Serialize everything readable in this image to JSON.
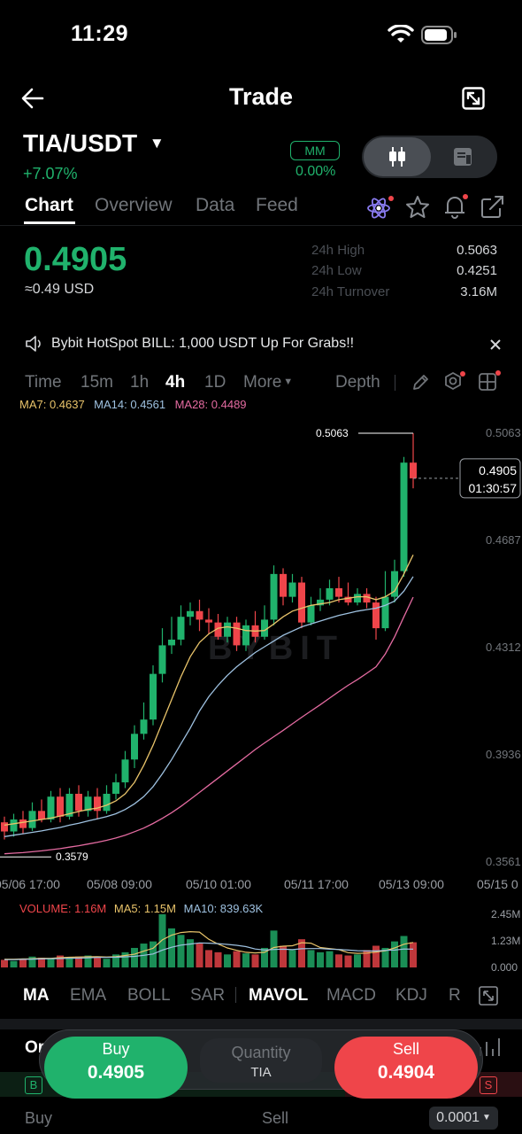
{
  "status": {
    "time": "11:29"
  },
  "header": {
    "title": "Trade"
  },
  "pair": {
    "symbol": "TIA/USDT",
    "change": "+7.07%",
    "mm_badge": "MM",
    "mm_value": "0.00%"
  },
  "tabs": [
    {
      "label": "Chart"
    },
    {
      "label": "Overview"
    },
    {
      "label": "Data"
    },
    {
      "label": "Feed"
    }
  ],
  "price": {
    "last": "0.4905",
    "usd": "≈0.49 USD"
  },
  "stats": [
    {
      "label": "24h High",
      "value": "0.5063"
    },
    {
      "label": "24h Low",
      "value": "0.4251"
    },
    {
      "label": "24h Turnover",
      "value": "3.16M"
    }
  ],
  "announcement": {
    "text": "Bybit HotSpot BILL: 1,000 USDT Up For Grabs!!"
  },
  "timeframes": [
    {
      "label": "Time"
    },
    {
      "label": "15m"
    },
    {
      "label": "1h"
    },
    {
      "label": "4h"
    },
    {
      "label": "1D"
    },
    {
      "label": "More"
    }
  ],
  "depth_label": "Depth",
  "ma_legend": {
    "ma7": "MA7: 0.4637",
    "ma14": "MA14: 0.4561",
    "ma28": "MA28: 0.4489"
  },
  "chart_data": {
    "type": "candlestick",
    "y_ticks": [
      "0.5063",
      "0.4687",
      "0.4312",
      "0.3936",
      "0.3561"
    ],
    "x_ticks": [
      "05/06 17:00",
      "05/08 09:00",
      "05/10 01:00",
      "05/11 17:00",
      "05/13 09:00",
      "05/15 0"
    ],
    "high_marker": "0.5063",
    "low_marker": "0.3579",
    "current_price": "0.4905",
    "countdown": "01:30:57",
    "watermark": "BYBIT",
    "ylim": [
      0.3561,
      0.5063
    ],
    "candles": [
      [
        0.37,
        0.3668,
        0.372,
        0.364
      ],
      [
        0.3668,
        0.371,
        0.373,
        0.365
      ],
      [
        0.371,
        0.368,
        0.374,
        0.366
      ],
      [
        0.368,
        0.374,
        0.377,
        0.367
      ],
      [
        0.374,
        0.371,
        0.378,
        0.37
      ],
      [
        0.371,
        0.379,
        0.381,
        0.37
      ],
      [
        0.379,
        0.372,
        0.382,
        0.37
      ],
      [
        0.372,
        0.38,
        0.382,
        0.371
      ],
      [
        0.38,
        0.374,
        0.383,
        0.372
      ],
      [
        0.374,
        0.379,
        0.381,
        0.372
      ],
      [
        0.379,
        0.374,
        0.382,
        0.371
      ],
      [
        0.374,
        0.38,
        0.383,
        0.373
      ],
      [
        0.38,
        0.384,
        0.387,
        0.378
      ],
      [
        0.384,
        0.392,
        0.395,
        0.382
      ],
      [
        0.392,
        0.401,
        0.404,
        0.389
      ],
      [
        0.401,
        0.406,
        0.412,
        0.399
      ],
      [
        0.406,
        0.422,
        0.425,
        0.404
      ],
      [
        0.422,
        0.432,
        0.438,
        0.419
      ],
      [
        0.432,
        0.434,
        0.442,
        0.429
      ],
      [
        0.434,
        0.442,
        0.446,
        0.432
      ],
      [
        0.442,
        0.444,
        0.447,
        0.439
      ],
      [
        0.444,
        0.441,
        0.448,
        0.437
      ],
      [
        0.441,
        0.44,
        0.445,
        0.436
      ],
      [
        0.44,
        0.435,
        0.443,
        0.434
      ],
      [
        0.435,
        0.44,
        0.442,
        0.433
      ],
      [
        0.44,
        0.432,
        0.442,
        0.43
      ],
      [
        0.432,
        0.439,
        0.441,
        0.43
      ],
      [
        0.439,
        0.435,
        0.444,
        0.433
      ],
      [
        0.435,
        0.441,
        0.446,
        0.434
      ],
      [
        0.441,
        0.457,
        0.46,
        0.439
      ],
      [
        0.457,
        0.449,
        0.459,
        0.446
      ],
      [
        0.449,
        0.454,
        0.457,
        0.447
      ],
      [
        0.454,
        0.44,
        0.456,
        0.438
      ],
      [
        0.44,
        0.446,
        0.449,
        0.439
      ],
      [
        0.446,
        0.448,
        0.452,
        0.444
      ],
      [
        0.448,
        0.452,
        0.455,
        0.446
      ],
      [
        0.452,
        0.449,
        0.456,
        0.447
      ],
      [
        0.449,
        0.447,
        0.454,
        0.446
      ],
      [
        0.447,
        0.45,
        0.452,
        0.446
      ],
      [
        0.45,
        0.447,
        0.452,
        0.445
      ],
      [
        0.447,
        0.438,
        0.449,
        0.434
      ],
      [
        0.438,
        0.449,
        0.458,
        0.437
      ],
      [
        0.449,
        0.458,
        0.462,
        0.447
      ],
      [
        0.458,
        0.496,
        0.498,
        0.456
      ],
      [
        0.496,
        0.4905,
        0.5063,
        0.487
      ]
    ],
    "ma7": [
      0.369,
      0.3695,
      0.37,
      0.3705,
      0.371,
      0.3715,
      0.3722,
      0.373,
      0.3738,
      0.3745,
      0.375,
      0.376,
      0.3775,
      0.38,
      0.384,
      0.39,
      0.397,
      0.405,
      0.413,
      0.421,
      0.428,
      0.433,
      0.436,
      0.438,
      0.4385,
      0.438,
      0.4372,
      0.437,
      0.4372,
      0.4395,
      0.442,
      0.444,
      0.445,
      0.446,
      0.4465,
      0.447,
      0.448,
      0.4485,
      0.449,
      0.449,
      0.448,
      0.449,
      0.451,
      0.457,
      0.4637
    ],
    "ma14": [
      0.365,
      0.3655,
      0.366,
      0.3665,
      0.367,
      0.3676,
      0.3682,
      0.369,
      0.3697,
      0.3705,
      0.3712,
      0.372,
      0.373,
      0.3745,
      0.3765,
      0.379,
      0.3825,
      0.387,
      0.392,
      0.3975,
      0.403,
      0.409,
      0.414,
      0.418,
      0.4215,
      0.4245,
      0.427,
      0.4295,
      0.4315,
      0.4335,
      0.4355,
      0.437,
      0.4385,
      0.4395,
      0.4405,
      0.4415,
      0.4425,
      0.4432,
      0.444,
      0.4445,
      0.445,
      0.446,
      0.4475,
      0.451,
      0.4561
    ],
    "ma28": [
      0.359,
      0.3592,
      0.3594,
      0.3597,
      0.36,
      0.3604,
      0.3608,
      0.3613,
      0.3618,
      0.3624,
      0.363,
      0.3637,
      0.3645,
      0.3655,
      0.3667,
      0.368,
      0.3696,
      0.3714,
      0.3734,
      0.3756,
      0.378,
      0.3805,
      0.383,
      0.3855,
      0.388,
      0.3905,
      0.393,
      0.3955,
      0.3978,
      0.4,
      0.4022,
      0.4045,
      0.4068,
      0.409,
      0.4112,
      0.4135,
      0.4158,
      0.418,
      0.42,
      0.4222,
      0.4245,
      0.429,
      0.435,
      0.442,
      0.4489
    ]
  },
  "volume": {
    "legend": {
      "volume": "VOLUME: 1.16M",
      "ma5": "MA5: 1.15M",
      "ma10": "MA10: 839.63K"
    },
    "y_ticks": [
      "2.45M",
      "1.23M",
      "0.000"
    ],
    "values": [
      0.35,
      0.3,
      0.4,
      0.5,
      0.45,
      0.4,
      0.55,
      0.45,
      0.5,
      0.55,
      0.45,
      0.4,
      0.6,
      0.7,
      0.9,
      1.1,
      1.2,
      2.45,
      1.8,
      1.5,
      1.3,
      1.1,
      0.8,
      0.7,
      0.6,
      0.75,
      0.65,
      0.6,
      0.9,
      1.7,
      1.0,
      0.8,
      1.3,
      0.8,
      0.7,
      0.75,
      0.6,
      0.55,
      0.6,
      0.8,
      1.0,
      0.9,
      1.2,
      1.45,
      1.16
    ],
    "ma5": [
      0.38,
      0.38,
      0.39,
      0.4,
      0.42,
      0.42,
      0.45,
      0.47,
      0.48,
      0.49,
      0.5,
      0.48,
      0.5,
      0.55,
      0.61,
      0.75,
      0.88,
      1.27,
      1.49,
      1.61,
      1.65,
      1.63,
      1.3,
      1.08,
      0.9,
      0.79,
      0.7,
      0.67,
      0.7,
      0.92,
      0.98,
      1.0,
      1.14,
      1.12,
      0.92,
      0.87,
      0.82,
      0.68,
      0.65,
      0.66,
      0.71,
      0.77,
      0.9,
      1.07,
      1.15
    ],
    "ma10": [
      0.36,
      0.36,
      0.37,
      0.38,
      0.39,
      0.4,
      0.41,
      0.42,
      0.43,
      0.44,
      0.46,
      0.46,
      0.47,
      0.49,
      0.51,
      0.56,
      0.62,
      0.8,
      0.93,
      1.03,
      1.08,
      1.13,
      1.12,
      1.1,
      1.06,
      1.02,
      0.96,
      0.85,
      0.8,
      0.83,
      0.84,
      0.82,
      0.86,
      0.87,
      0.87,
      0.84,
      0.83,
      0.8,
      0.77,
      0.76,
      0.76,
      0.79,
      0.8,
      0.85,
      0.84
    ]
  },
  "indicators": [
    {
      "label": "MA"
    },
    {
      "label": "EMA"
    },
    {
      "label": "BOLL"
    },
    {
      "label": "SAR"
    },
    {
      "label": "MAVOL"
    },
    {
      "label": "MACD"
    },
    {
      "label": "KDJ"
    },
    {
      "label": "R"
    }
  ],
  "orderbook": {
    "title": "Or",
    "buy_badge": "B",
    "sell_badge": "S",
    "col_buy": "Buy",
    "col_sell": "Sell",
    "precision": "0.0001"
  },
  "actions": {
    "buy_label": "Buy",
    "buy_price": "0.4905",
    "qty_label": "Quantity",
    "qty_unit": "TIA",
    "sell_label": "Sell",
    "sell_price": "0.4904"
  },
  "colors": {
    "up": "#20b26c",
    "down": "#ef454a",
    "ma7": "#e8c36a",
    "ma14": "#9ec1e0",
    "ma28": "#e46ba1",
    "bg": "#000000"
  }
}
